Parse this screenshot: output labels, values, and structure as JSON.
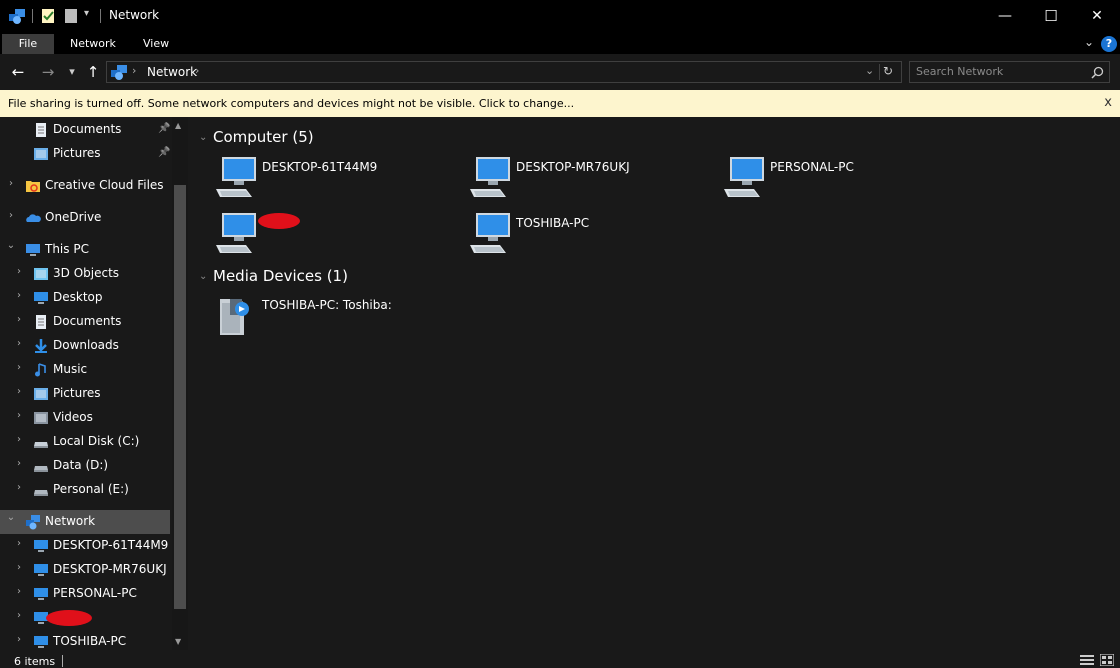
{
  "window": {
    "title": "Network",
    "minimize": "—",
    "maximize": "☐",
    "close": "✕"
  },
  "ribbon": {
    "tabs": [
      "File",
      "Network",
      "View"
    ],
    "help": "?"
  },
  "nav": {
    "back": "←",
    "forward": "→",
    "recent": "▾",
    "up": "↑",
    "address_path": "Network",
    "search_placeholder": "Search Network"
  },
  "infobar": {
    "message": "File sharing is turned off. Some network computers and devices might not be visible. Click to change...",
    "close": "x"
  },
  "sidebar": {
    "items": [
      {
        "label": "Documents",
        "icon": "documents-icon",
        "pinned": true
      },
      {
        "label": "Pictures",
        "icon": "pictures-icon",
        "pinned": true
      },
      {
        "label": "Creative Cloud Files",
        "icon": "creative-cloud-icon"
      },
      {
        "label": "OneDrive",
        "icon": "onedrive-icon"
      },
      {
        "label": "This PC",
        "icon": "this-pc-icon"
      },
      {
        "label": "3D Objects",
        "icon": "3d-objects-icon"
      },
      {
        "label": "Desktop",
        "icon": "desktop-icon"
      },
      {
        "label": "Documents",
        "icon": "documents-icon"
      },
      {
        "label": "Downloads",
        "icon": "downloads-icon"
      },
      {
        "label": "Music",
        "icon": "music-icon"
      },
      {
        "label": "Pictures",
        "icon": "pictures-icon"
      },
      {
        "label": "Videos",
        "icon": "videos-icon"
      },
      {
        "label": "Local Disk (C:)",
        "icon": "local-disk-icon"
      },
      {
        "label": "Data (D:)",
        "icon": "drive-icon"
      },
      {
        "label": "Personal (E:)",
        "icon": "drive-icon"
      },
      {
        "label": "Network",
        "icon": "network-icon",
        "selected": true
      },
      {
        "label": "DESKTOP-61T44M9",
        "icon": "computer-icon"
      },
      {
        "label": "DESKTOP-MR76UKJ",
        "icon": "computer-icon"
      },
      {
        "label": "PERSONAL-PC",
        "icon": "computer-icon"
      },
      {
        "label": "",
        "icon": "computer-icon",
        "redacted": true
      },
      {
        "label": "TOSHIBA-PC",
        "icon": "computer-icon"
      }
    ]
  },
  "content": {
    "groups": [
      {
        "title": "Computer (5)",
        "items": [
          {
            "label": "DESKTOP-61T44M9"
          },
          {
            "label": "DESKTOP-MR76UKJ"
          },
          {
            "label": "PERSONAL-PC"
          },
          {
            "label": "",
            "redacted": true
          },
          {
            "label": "TOSHIBA-PC"
          }
        ]
      },
      {
        "title": "Media Devices (1)",
        "items": [
          {
            "label": "TOSHIBA-PC: Toshiba:"
          }
        ]
      }
    ]
  },
  "status": {
    "item_count": "6 items"
  },
  "colors": {
    "background": "#191919",
    "titlebar": "#000000",
    "infobar": "#fdf5ce",
    "selection": "#4d4d4d",
    "accent": "#1a74d4",
    "redaction": "#e0101a"
  }
}
